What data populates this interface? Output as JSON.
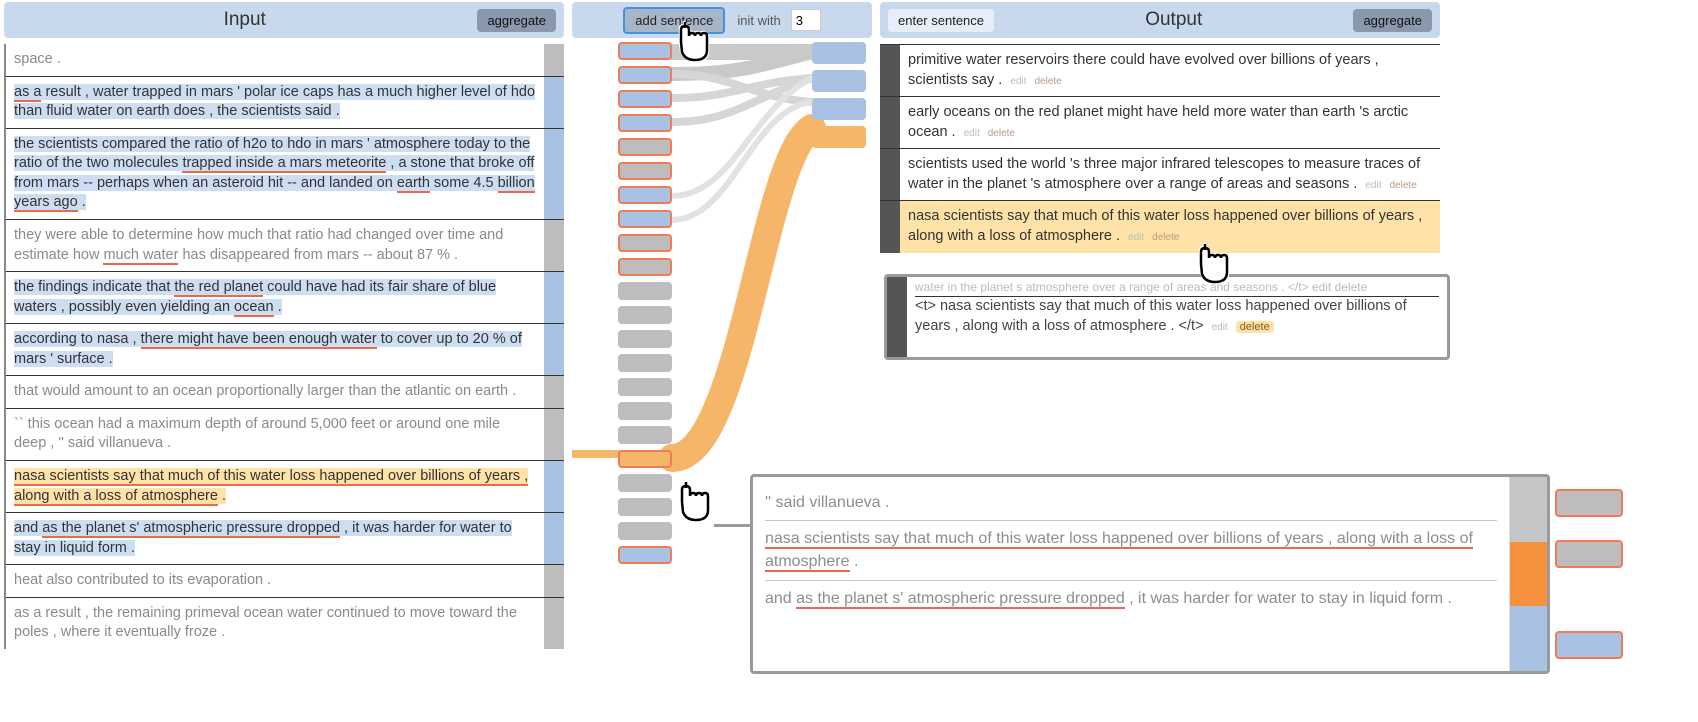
{
  "input": {
    "title": "Input",
    "aggregate": "aggregate",
    "rows": [
      {
        "text": "space .",
        "dim": true,
        "bar": "gray"
      },
      {
        "segments": [
          [
            "as a",
            "u"
          ],
          [
            " ",
            "p"
          ],
          [
            "result",
            ""
          ],
          [
            " , ",
            "p"
          ],
          [
            "water trapped in mars ' polar ice caps has a much higher level of hdo than fluid water on earth does , the scientists said",
            ""
          ],
          [
            " .",
            "p"
          ]
        ],
        "hl": "blue",
        "bar": "blue"
      },
      {
        "segments": [
          [
            "the scientists compared the ratio of h2o to hdo in mars ' atmosphere today to the ratio of the two molecules",
            ""
          ],
          [
            " ",
            "p"
          ],
          [
            "trapped inside a mars meteorite",
            "u"
          ],
          [
            " , ",
            "p"
          ],
          [
            "a stone that broke off from mars -- perhaps when an asteroid hit -- and landed on",
            ""
          ],
          [
            " ",
            "p"
          ],
          [
            "earth",
            "u"
          ],
          [
            " some 4.5 ",
            "p"
          ],
          [
            "billion years ago",
            "u"
          ],
          [
            " .",
            "p"
          ]
        ],
        "hl": "blue",
        "bar": "blue"
      },
      {
        "segments": [
          [
            "they were able to determine how much that ratio had changed over time and estimate how",
            ""
          ],
          [
            " ",
            "p"
          ],
          [
            "much water",
            "u"
          ],
          [
            " has disappeared from mars -- about 87 % .",
            "p"
          ]
        ],
        "dim": true,
        "bar": "gray"
      },
      {
        "segments": [
          [
            "the findings indicate that",
            ""
          ],
          [
            " ",
            "p"
          ],
          [
            "the red planet",
            "u"
          ],
          [
            " could have had its fair share of blue waters , possibly even yielding an ",
            "p"
          ],
          [
            "ocean",
            "u"
          ],
          [
            " .",
            "p"
          ]
        ],
        "hl": "blue",
        "bar": "blue"
      },
      {
        "segments": [
          [
            "according to nasa",
            ""
          ],
          [
            " , ",
            "p"
          ],
          [
            "there might have been enough water",
            "u"
          ],
          [
            " to cover up to 20 % of mars ' surface .",
            "p"
          ]
        ],
        "hl": "blue",
        "bar": "blue"
      },
      {
        "text": "that would amount to an ocean proportionally larger than the atlantic on earth .",
        "dim": true,
        "bar": "gray"
      },
      {
        "text": "`` this ocean had a maximum depth of around 5,000 feet or around one mile deep , '' said villanueva .",
        "dim": true,
        "bar": "gray"
      },
      {
        "segments": [
          [
            "nasa scientists say that much of this water loss happened over billions of years , along with a loss of atmosphere",
            "u"
          ],
          [
            " .",
            "p"
          ]
        ],
        "hl": "orange",
        "bar": "blue"
      },
      {
        "segments": [
          [
            "and",
            ""
          ],
          [
            " ",
            "p"
          ],
          [
            "as the planet s' atmospheric pressure dropped",
            "u"
          ],
          [
            " , it was harder for water to stay in liquid form .",
            "p"
          ]
        ],
        "hl": "blue",
        "bar": "blue"
      },
      {
        "text": "heat also contributed to its evaporation .",
        "dim": true,
        "bar": "gray"
      },
      {
        "text": "as a result , the remaining primeval ocean water continued to move toward the poles , where it eventually froze .",
        "dim": true,
        "bar": "gray"
      }
    ]
  },
  "middle": {
    "add_sentence": "add sentence",
    "init_with_label": "init with",
    "init_with_value": "3",
    "left_boxes": [
      {
        "c": "blue",
        "sel": true
      },
      {
        "c": "blue",
        "sel": true
      },
      {
        "c": "blue",
        "sel": true
      },
      {
        "c": "blue",
        "sel": true
      },
      {
        "c": "gray",
        "sel": true
      },
      {
        "c": "gray",
        "sel": true
      },
      {
        "c": "blue",
        "sel": true
      },
      {
        "c": "blue",
        "sel": true
      },
      {
        "c": "gray",
        "sel": true
      },
      {
        "c": "gray",
        "sel": true
      },
      {
        "c": "gray",
        "sel": false
      },
      {
        "c": "gray",
        "sel": false
      },
      {
        "c": "gray",
        "sel": false
      },
      {
        "c": "gray",
        "sel": false
      },
      {
        "c": "gray",
        "sel": false
      },
      {
        "c": "gray",
        "sel": false
      },
      {
        "c": "gray",
        "sel": false
      },
      {
        "c": "orange",
        "sel": true
      },
      {
        "c": "gray",
        "sel": false
      },
      {
        "c": "gray",
        "sel": false
      },
      {
        "c": "gray",
        "sel": false
      },
      {
        "c": "blue",
        "sel": true
      }
    ],
    "right_boxes": [
      {
        "c": "blue",
        "sel": false
      },
      {
        "c": "blue",
        "sel": false
      },
      {
        "c": "blue",
        "sel": false
      },
      {
        "c": "orange",
        "sel": false
      }
    ]
  },
  "output": {
    "title": "Output",
    "aggregate": "aggregate",
    "enter_sentence": "enter sentence",
    "edit": "edit",
    "del": "delete",
    "rows": [
      {
        "text": "<t> primitive water reservoirs there could have evolved over billions of years , scientists say . </t>",
        "hl": false
      },
      {
        "text": "<t> early oceans on the red planet might have held more water than earth 's arctic ocean . </t>",
        "hl": false
      },
      {
        "text": "<t> scientists used the world 's three major infrared telescopes to measure traces of water in the planet 's atmosphere over a range of areas and seasons . </t>",
        "hl": false
      },
      {
        "text": "<t> nasa scientists say that much of this water loss happened over billions of years , along with a loss of atmosphere . </t>",
        "hl": true
      }
    ],
    "inset": {
      "clipped": "water in the planet s atmosphere over a range of areas and seasons . </t>  edit  delete",
      "text": "<t> nasa scientists say that much of this water loss happened over billions of years , along with a loss of atmosphere . </t>"
    }
  },
  "big_inset": {
    "rows": [
      {
        "text": "'' said villanueva ."
      },
      {
        "segments": [
          [
            "nasa scientists say that much of this water loss happened over billions of years , along with a loss of atmosphere",
            "u"
          ],
          [
            " .",
            "p"
          ]
        ]
      },
      {
        "segments": [
          [
            "and ",
            ""
          ],
          [
            "as the planet s' atmospheric pressure dropped",
            "u"
          ],
          [
            " , it was harder for water to stay in liquid form .",
            "p"
          ]
        ]
      }
    ],
    "right_proxies": [
      {
        "c": "gray",
        "sel": true
      },
      {
        "c": "gray",
        "sel": true
      },
      {
        "c": "blue",
        "sel": true
      }
    ]
  }
}
